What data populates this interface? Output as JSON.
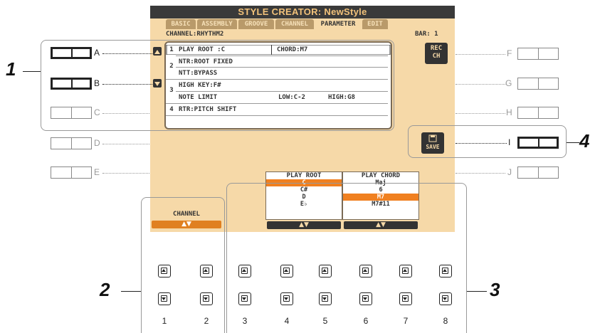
{
  "lcd": {
    "title": "STYLE CREATOR: NewStyle",
    "tabs": [
      "BASIC",
      "ASSEMBLY",
      "GROOVE",
      "CHANNEL",
      "PARAMETER",
      "EDIT"
    ],
    "active_tab": "PARAMETER",
    "channel": "CHANNEL:RHYTHM2",
    "bar": "BAR:  1",
    "rows": [
      {
        "num": "1",
        "text": "PLAY ROOT  :C",
        "text2": "CHORD:M7"
      },
      {
        "num": "2",
        "text": "NTR:ROOT FIXED"
      },
      {
        "num": "",
        "text": "NTT:BYPASS"
      },
      {
        "num": "3",
        "text": "HIGH KEY:F#"
      },
      {
        "num": "",
        "text": "NOTE LIMIT",
        "low": "LOW:C-2",
        "high": "HIGH:G8"
      },
      {
        "num": "4",
        "text": "RTR:PITCH SHIFT"
      }
    ],
    "rec_ch": [
      "REC",
      "CH"
    ],
    "save_label": "SAVE",
    "play_root": {
      "title": "PLAY ROOT",
      "options": [
        "C",
        "C#",
        "D",
        "E♭"
      ],
      "selected": "C"
    },
    "play_chord": {
      "title": "PLAY CHORD",
      "options": [
        "Maj",
        "6",
        "M7",
        "M7#11"
      ],
      "selected": "M7"
    },
    "channel_label": "CHANNEL",
    "updown": "▲▼"
  },
  "side_left": [
    "A",
    "B",
    "C",
    "D",
    "E"
  ],
  "side_right": [
    "F",
    "G",
    "H",
    "I",
    "J"
  ],
  "callouts": [
    "1",
    "2",
    "3",
    "4"
  ],
  "button_numbers": [
    "1",
    "2",
    "3",
    "4",
    "5",
    "6",
    "7",
    "8"
  ]
}
